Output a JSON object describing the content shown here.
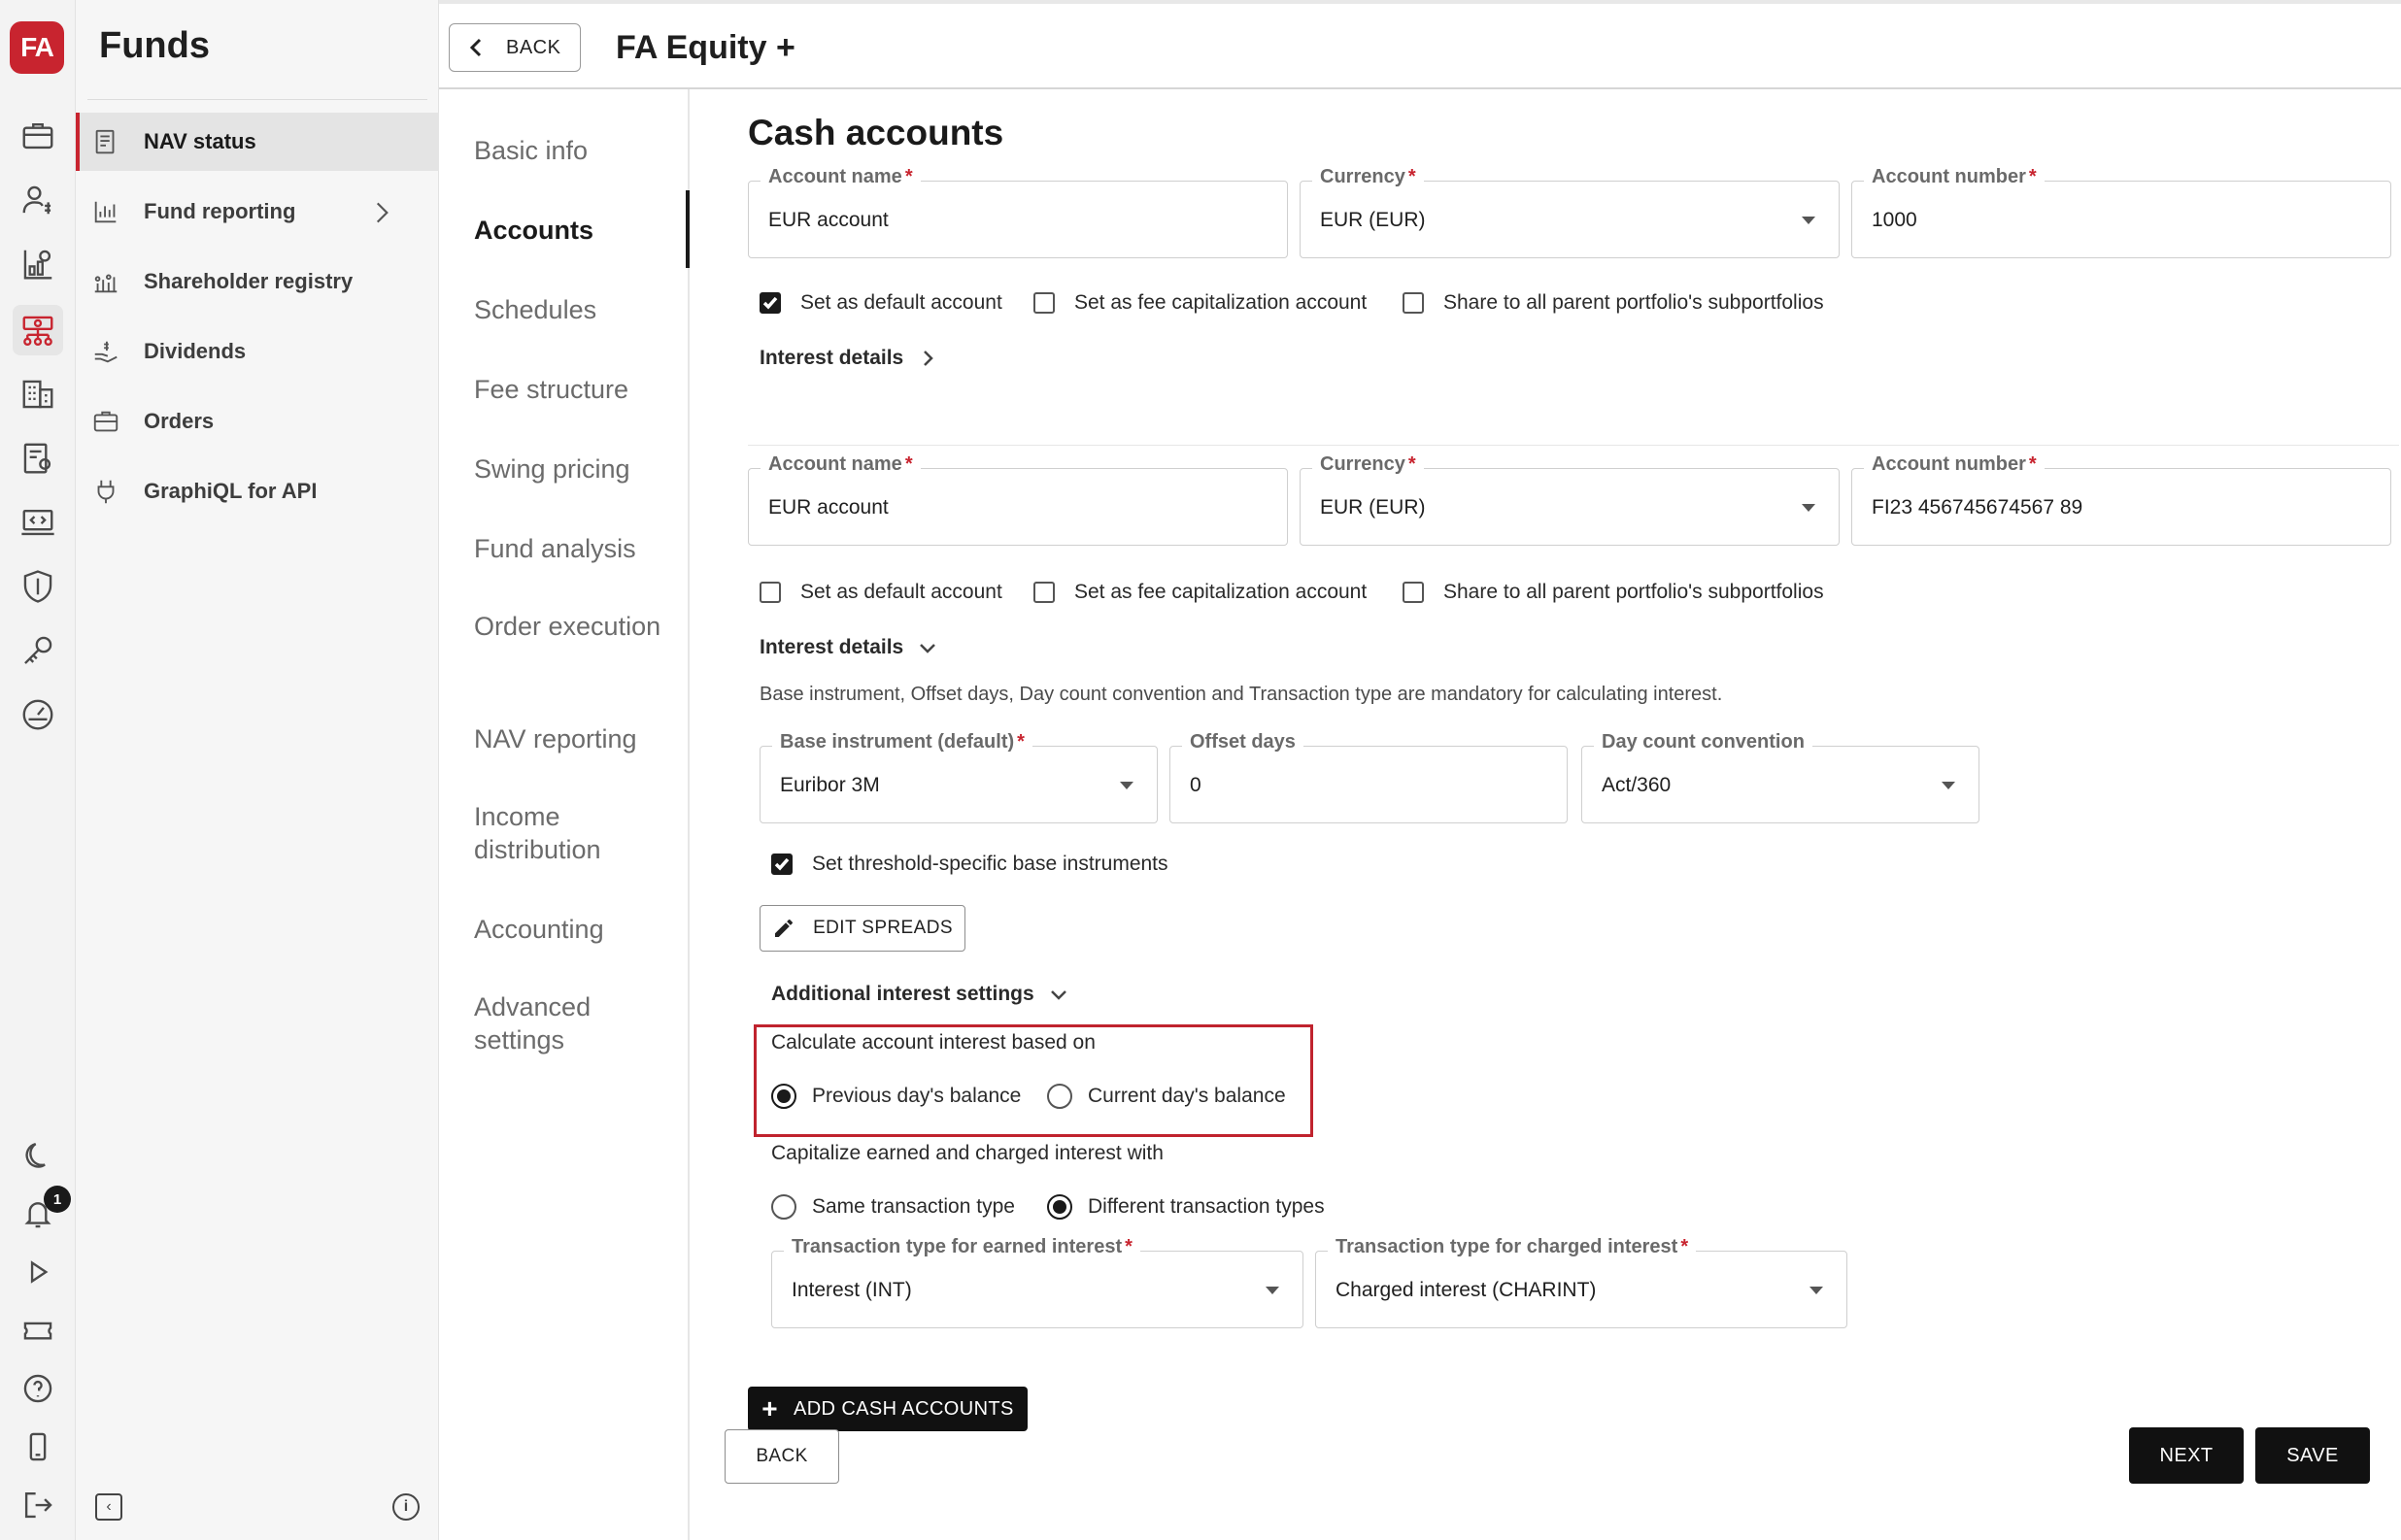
{
  "rail": {
    "logo": "FA",
    "notifications_count": "1"
  },
  "nav": {
    "title": "Funds",
    "items": [
      {
        "label": "NAV status",
        "icon": "nav-status-icon"
      },
      {
        "label": "Fund reporting",
        "icon": "chart-icon"
      },
      {
        "label": "Shareholder registry",
        "icon": "registry-icon"
      },
      {
        "label": "Dividends",
        "icon": "dividends-icon"
      },
      {
        "label": "Orders",
        "icon": "briefcase-icon"
      },
      {
        "label": "GraphiQL for API",
        "icon": "plug-icon"
      }
    ]
  },
  "header": {
    "back_label": "BACK",
    "title": "FA Equity +"
  },
  "tabs": [
    "Basic info",
    "Accounts",
    "Schedules",
    "Fee structure",
    "Swing pricing",
    "Fund analysis",
    "Order execution",
    "NAV reporting",
    "Income distribution",
    "Accounting",
    "Advanced settings"
  ],
  "main": {
    "section_title": "Cash accounts",
    "labels": {
      "account_name": "Account name",
      "currency": "Currency",
      "account_number": "Account number",
      "required_mark": "*",
      "set_default": "Set as default account",
      "set_fee_cap": "Set as fee capitalization account",
      "share_parent": "Share to all parent portfolio's subportfolios",
      "interest_details": "Interest details"
    },
    "account1": {
      "name": "EUR account",
      "currency": "EUR (EUR)",
      "number": "1000"
    },
    "account2": {
      "name": "EUR account",
      "currency": "EUR (EUR)",
      "number": "FI23 456745674567 89",
      "interest_note": "Base instrument, Offset days, Day count convention and Transaction type are mandatory for calculating interest.",
      "base_instrument_label": "Base instrument (default)",
      "base_instrument_value": "Euribor 3M",
      "offset_days_label": "Offset days",
      "offset_days_value": "0",
      "day_count_label": "Day count convention",
      "day_count_value": "Act/360",
      "threshold_label": "Set threshold-specific base instruments",
      "edit_spreads": "EDIT SPREADS",
      "additional_settings": "Additional interest settings",
      "calc_basis_label": "Calculate account interest based on",
      "prev_balance": "Previous day's balance",
      "curr_balance": "Current day's balance",
      "capitalize_label": "Capitalize earned and charged interest with",
      "same_type": "Same transaction type",
      "diff_types": "Different transaction types",
      "earned_type_label": "Transaction type for earned interest",
      "earned_type_value": "Interest (INT)",
      "charged_type_label": "Transaction type for charged interest",
      "charged_type_value": "Charged interest (CHARINT)"
    },
    "add_cash_accounts": "ADD CASH ACCOUNTS"
  },
  "footer": {
    "back": "BACK",
    "next": "NEXT",
    "save": "SAVE"
  }
}
